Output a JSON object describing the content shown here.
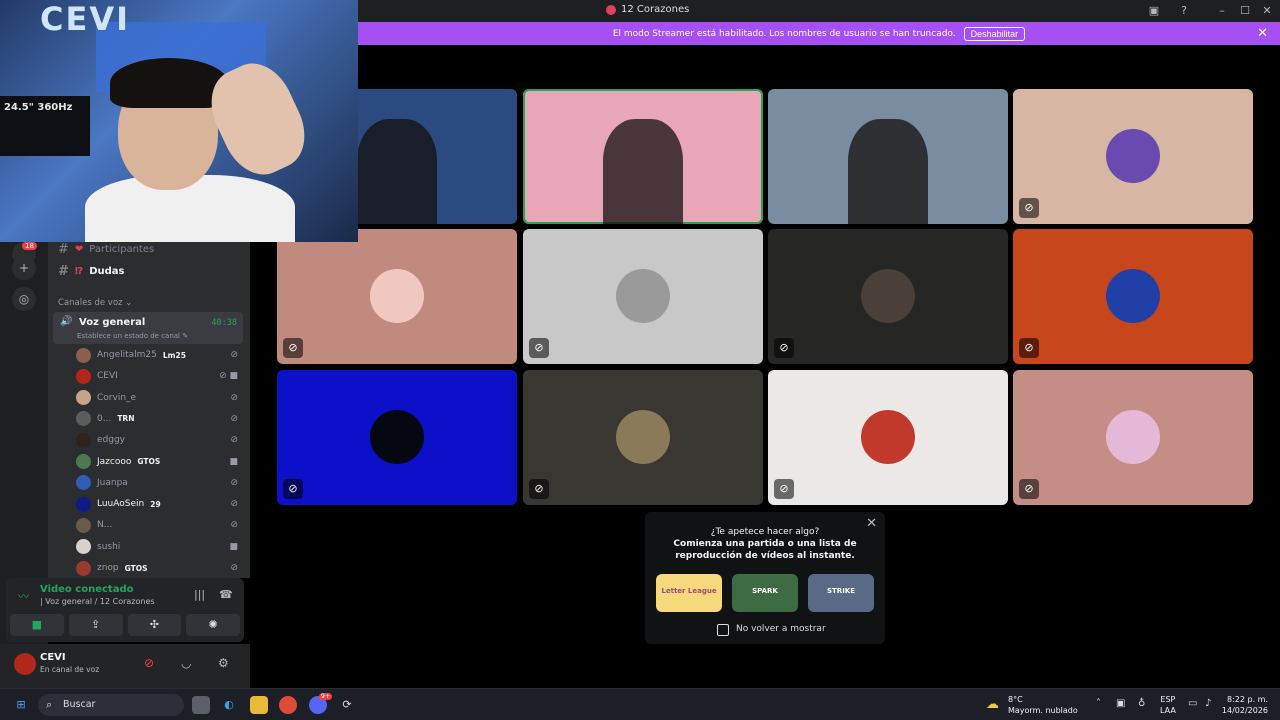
{
  "window": {
    "title": "12 Corazones"
  },
  "banner": {
    "text": "El modo Streamer está habilitado. Los nombres de usuario se han truncado.",
    "button": "Deshabilitar"
  },
  "rail": {
    "badge": "18"
  },
  "channels": [
    {
      "name": "Participantes",
      "style": "dim",
      "emoji": "❤"
    },
    {
      "name": "Dudas",
      "style": "bold",
      "emoji": "⁉"
    }
  ],
  "voice_category": "Canales de voz",
  "voice_channel": {
    "name": "Voz general",
    "timer": "40:38",
    "status_hint": "Establece un estado de canal"
  },
  "members": [
    {
      "name": "Angelitalm25",
      "tag": "Lm25",
      "right": "mic-off",
      "av": "#8b5e4e"
    },
    {
      "name": "CEVI",
      "tag": "",
      "right": "mic-off-cam",
      "av": "#b3271b"
    },
    {
      "name": "Corvin_e",
      "tag": "",
      "right": "mic-off",
      "av": "#c9a28c"
    },
    {
      "name": "0...",
      "tag": "TRN",
      "right": "mic-off",
      "av": "#5c5c5c"
    },
    {
      "name": "edggy",
      "tag": "",
      "right": "mic-off",
      "av": "#2b2421"
    },
    {
      "name": "Jazcooo",
      "tag": "GTOS",
      "right": "cam",
      "av": "#4c7a4e",
      "highlight": true
    },
    {
      "name": "Juanpa",
      "tag": "",
      "right": "mic-off",
      "av": "#2e5cb8"
    },
    {
      "name": "LuuAoSein",
      "tag": "29",
      "right": "mic-off",
      "av": "#101a88",
      "highlight": true
    },
    {
      "name": "N...",
      "tag": "",
      "right": "mic-off",
      "av": "#6b5a4a"
    },
    {
      "name": "sushi",
      "tag": "",
      "right": "cam",
      "av": "#d8d2cf"
    },
    {
      "name": "znop",
      "tag": "GTOS",
      "right": "mic-off",
      "av": "#9a3a2e"
    }
  ],
  "voice_connected": {
    "title": "Video conectado",
    "subtitle": "| Voz general / 12 Corazones"
  },
  "user": {
    "name": "CEVI",
    "status": "En canal de voz"
  },
  "popup": {
    "title": "¿Te apetece hacer algo?",
    "line2": "Comienza una partida o una lista de",
    "line3": "reproducción de vídeos al instante.",
    "activities": [
      "Letter League",
      "SPARK",
      "STRIKE"
    ],
    "checkbox": "No volver a mostrar"
  },
  "taskbar": {
    "search": "Buscar",
    "weather_temp": "8°C",
    "weather_text": "Mayorm. nublado",
    "lang1": "ESP",
    "lang2": "LAA",
    "time": "8:22 p. m.",
    "date": "14/02/2026",
    "discord_badge": "9+"
  },
  "tiles": [
    {
      "kind": "video",
      "bg": "#2a4a80",
      "muted": false
    },
    {
      "kind": "video",
      "bg": "#e8a6b8",
      "muted": false,
      "speaking": true
    },
    {
      "kind": "video",
      "bg": "#7a8ca0",
      "muted": false
    },
    {
      "kind": "avatar",
      "bg": "#d8b6a4",
      "av": "#6a4ab0",
      "muted": true
    },
    {
      "kind": "avatar",
      "bg": "#c08a7e",
      "av": "#f0c8c0",
      "muted": true
    },
    {
      "kind": "avatar",
      "bg": "#c8c8c8",
      "av": "#9a9a9a",
      "muted": true
    },
    {
      "kind": "avatar",
      "bg": "#262624",
      "av": "#4a4038",
      "muted": true
    },
    {
      "kind": "avatar",
      "bg": "#c8461c",
      "av": "#2040a8",
      "muted": true
    },
    {
      "kind": "avatar",
      "bg": "#0c10c8",
      "av": "#050810",
      "muted": true
    },
    {
      "kind": "avatar",
      "bg": "#3a3632",
      "av": "#8a7a5a",
      "muted": true
    },
    {
      "kind": "avatar",
      "bg": "#ece8e6",
      "av": "#c0392b",
      "muted": true
    },
    {
      "kind": "avatar",
      "bg": "#c48e86",
      "av": "#e6b8d8",
      "muted": true
    }
  ],
  "cam": {
    "sign": "CEVI",
    "monitor": "24.5\" 360Hz"
  }
}
